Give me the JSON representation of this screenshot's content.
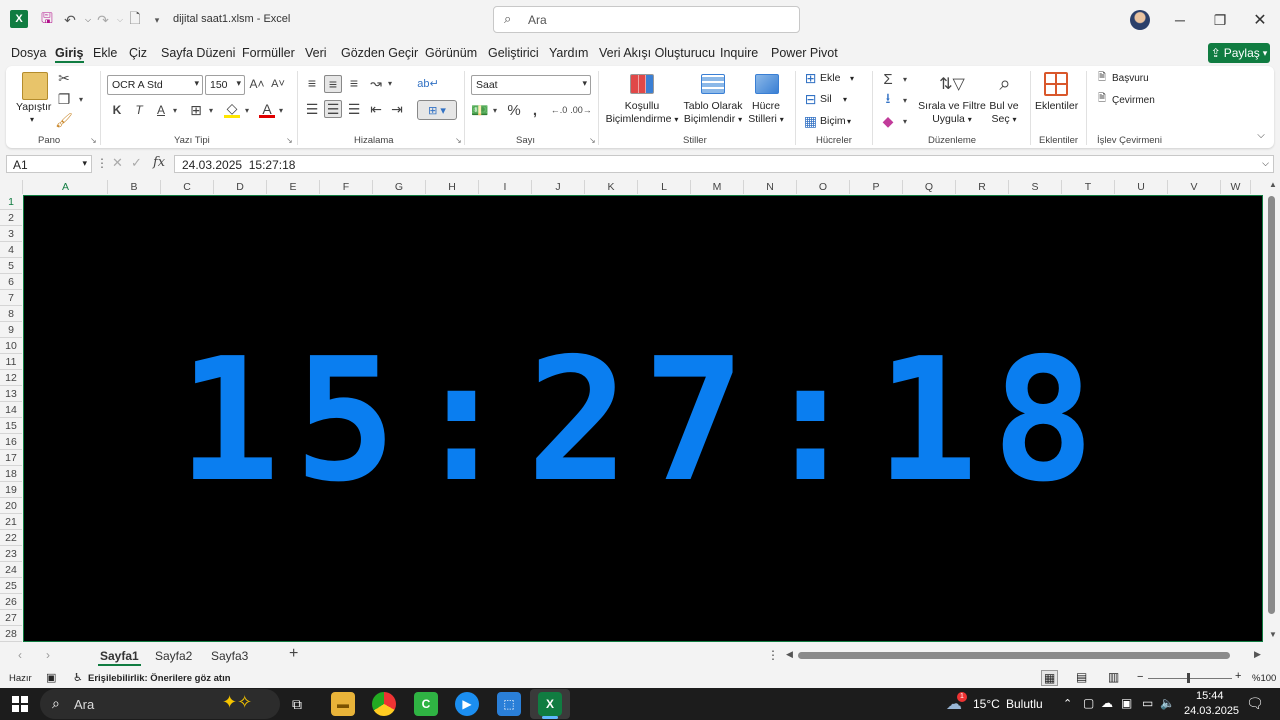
{
  "titlebar": {
    "doc_title": "dijital saat1.xlsm  -  Excel",
    "search_placeholder": "Ara",
    "app_logo_letter": "X"
  },
  "menu": {
    "tabs": [
      "Dosya",
      "Giriş",
      "Ekle",
      "Çiz",
      "Sayfa Düzeni",
      "Formüller",
      "Veri",
      "Gözden Geçir",
      "Görünüm",
      "Geliştirici",
      "Yardım",
      "Veri Akışı Oluşturucu",
      "Inquire",
      "Power Pivot"
    ],
    "active_tab": "Giriş",
    "share_label": "Paylaş"
  },
  "ribbon": {
    "clipboard": {
      "paste_label": "Yapıştır",
      "group_label": "Pano"
    },
    "font": {
      "name": "OCR A Std",
      "size": "150",
      "bold": "K",
      "italic": "T",
      "group_label": "Yazı Tipi"
    },
    "alignment": {
      "group_label": "Hizalama"
    },
    "number": {
      "format": "Saat",
      "group_label": "Sayı"
    },
    "styles": {
      "conditional_line1": "Koşullu",
      "conditional_line2": "Biçimlendirme",
      "table_line1": "Tablo Olarak",
      "table_line2": "Biçimlendir",
      "cell_styles_line1": "Hücre",
      "cell_styles_line2": "Stilleri",
      "group_label": "Stiller"
    },
    "cells": {
      "insert": "Ekle",
      "delete": "Sil",
      "format": "Biçim",
      "group_label": "Hücreler"
    },
    "editing": {
      "sort_line1": "Sırala ve Filtre",
      "sort_line2": "Uygula",
      "find_line1": "Bul ve",
      "find_line2": "Seç",
      "group_label": "Düzenleme"
    },
    "addins": {
      "label": "Eklentiler",
      "group_label": "Eklentiler"
    },
    "function_translator": {
      "reference": "Başvuru",
      "translate": "Çevirmen",
      "group_label": "İşlev Çevirmeni"
    }
  },
  "formula_bar": {
    "cell_ref": "A1",
    "fx": "fx",
    "content": "24.03.2025  15:27:18"
  },
  "grid": {
    "columns": [
      "A",
      "B",
      "C",
      "D",
      "E",
      "F",
      "G",
      "H",
      "I",
      "J",
      "K",
      "L",
      "M",
      "N",
      "O",
      "P",
      "Q",
      "R",
      "S",
      "T",
      "U",
      "V",
      "W"
    ],
    "rows": [
      "1",
      "2",
      "3",
      "4",
      "5",
      "6",
      "7",
      "8",
      "9",
      "10",
      "11",
      "12",
      "13",
      "14",
      "15",
      "16",
      "17",
      "18",
      "19",
      "20",
      "21",
      "22",
      "23",
      "24",
      "25",
      "26",
      "27",
      "28"
    ],
    "clock_text": "15:27:18",
    "clock_color": "#0a7ef0",
    "background_color": "#000000"
  },
  "sheets": {
    "tabs": [
      "Sayfa1",
      "Sayfa2",
      "Sayfa3"
    ],
    "active": "Sayfa1",
    "add_label": "+"
  },
  "statusbar": {
    "ready": "Hazır",
    "accessibility": "Erişilebilirlik: Önerilere göz atın",
    "zoom": "%100"
  },
  "taskbar": {
    "search_placeholder": "Ara",
    "weather_temp": "15°C",
    "weather_desc": "Bulutlu",
    "weather_badge": "1",
    "time": "15:44",
    "date": "24.03.2025"
  },
  "colors": {
    "accent_green": "#107c41",
    "clock_blue": "#0a7ef0"
  }
}
